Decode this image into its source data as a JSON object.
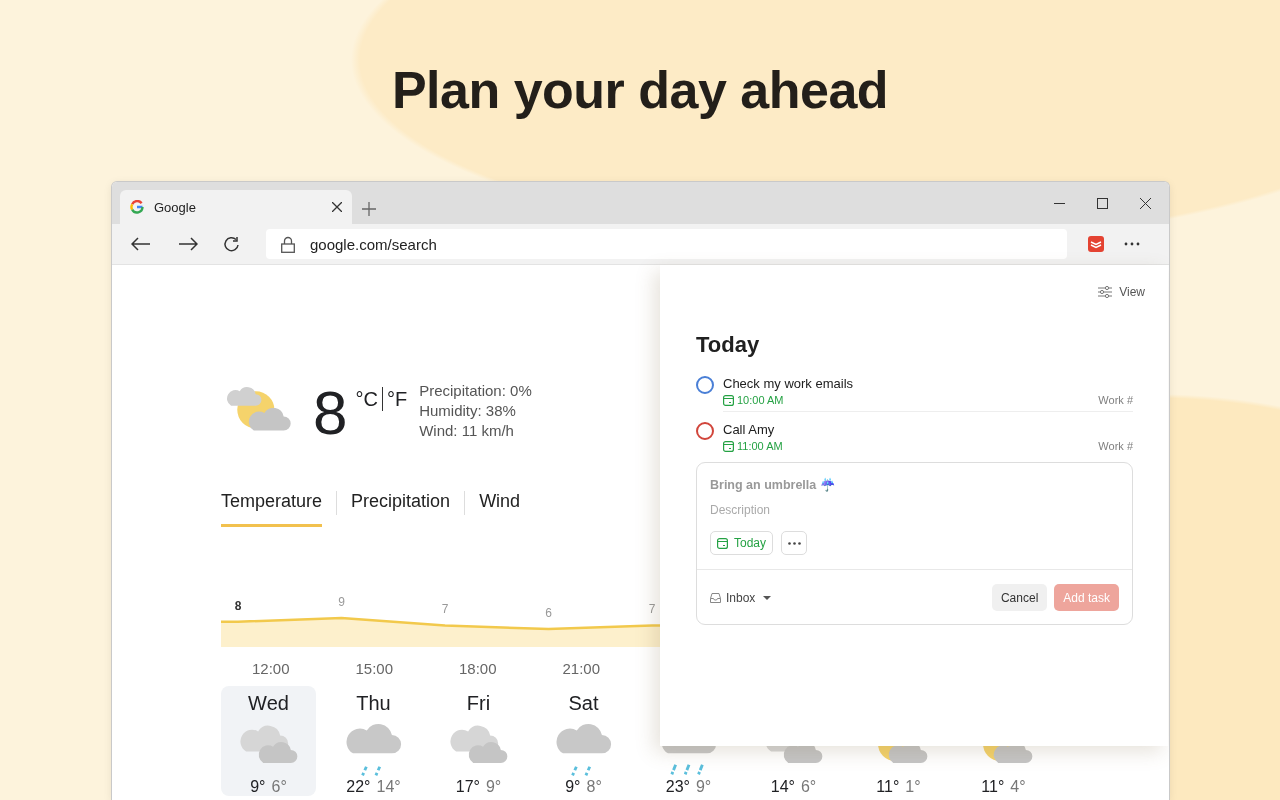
{
  "headline": "Plan your day ahead",
  "browser": {
    "tab": {
      "title": "Google",
      "selected": true
    },
    "address": "google.com/search"
  },
  "weather": {
    "current": {
      "kind": "partly-sunny",
      "temperature": "8",
      "unit_celsius": "°C",
      "unit_fahrenheit": "°F",
      "details": [
        "Precipitation: 0%",
        "Humidity: 38%",
        "Wind: 11 km/h"
      ]
    },
    "tabs": [
      {
        "label": "Temperature",
        "selected": true
      },
      {
        "label": "Precipitation",
        "selected": false
      },
      {
        "label": "Wind",
        "selected": false
      }
    ],
    "chart_labels": [
      {
        "value": "8",
        "selected": true
      },
      {
        "value": "9",
        "selected": false
      },
      {
        "value": "7",
        "selected": false
      },
      {
        "value": "6",
        "selected": false
      },
      {
        "value": "7",
        "selected": false
      }
    ],
    "times": [
      "12:00",
      "15:00",
      "18:00",
      "21:00"
    ],
    "days": [
      {
        "day": "Wed",
        "kind": "cloudy",
        "high": "9°",
        "low": "6°",
        "selected": true
      },
      {
        "day": "Thu",
        "kind": "rain",
        "high": "22°",
        "low": "14°",
        "selected": false
      },
      {
        "day": "Fri",
        "kind": "cloudy",
        "high": "17°",
        "low": "9°",
        "selected": false
      },
      {
        "day": "Sat",
        "kind": "rain",
        "high": "9°",
        "low": "8°",
        "selected": false
      },
      {
        "kind": "showers",
        "high": "23°",
        "low": "9°",
        "selected": false
      },
      {
        "kind": "cloudy",
        "high": "14°",
        "low": "6°",
        "selected": false
      },
      {
        "kind": "partly-sunny",
        "high": "11°",
        "low": "1°",
        "selected": false
      },
      {
        "kind": "partly-sunny",
        "high": "11°",
        "low": "4°",
        "selected": false
      }
    ]
  },
  "todo": {
    "view_button": "View",
    "title": "Today",
    "tasks": [
      {
        "name": "Check my work emails",
        "time": "10:00 AM",
        "project": "Work #",
        "color": "#4a7fd6"
      },
      {
        "name": "Call Amy",
        "time": "11:00 AM",
        "project": "Work #",
        "color": "#d1453b"
      }
    ],
    "editor": {
      "task_name": "Bring an umbrella ☔",
      "placeholder": "Description",
      "date_button": "Today",
      "project": "Inbox",
      "cancel_button": "Cancel",
      "submit_button": "Add task",
      "submit_disabled": true
    }
  }
}
